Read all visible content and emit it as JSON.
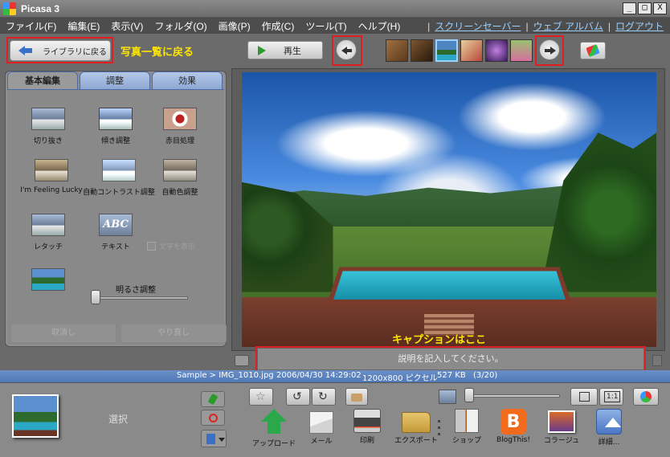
{
  "window": {
    "title": "Picasa 3",
    "buttons": [
      "_",
      "□",
      "X"
    ]
  },
  "menu": {
    "items": [
      "ファイル(F)",
      "編集(E)",
      "表示(V)",
      "フォルダ(O)",
      "画像(P)",
      "作成(C)",
      "ツール(T)",
      "ヘルプ(H)"
    ],
    "separator": "|",
    "links": [
      "スクリーンセーバー",
      "ウェブ アルバム",
      "ログアウト"
    ]
  },
  "toolbar": {
    "back_to_library": "ライブラリに戻る",
    "play": "再生"
  },
  "annotations": {
    "back_to_list": "写真一覧に戻る",
    "prev": "戻る",
    "next": "進む",
    "caption_here": "キャプションはここ"
  },
  "filmstrip_colors": [
    "#7a5530",
    "#5a3a1e",
    "#4e86c4",
    "#b8473a",
    "#6b3a8a",
    "#d76f9e"
  ],
  "panel": {
    "tabs": [
      "基本編集",
      "調整",
      "効果"
    ],
    "tools": [
      "切り抜き",
      "傾き調整",
      "赤目処理",
      "I'm Feeling Lucky",
      "自動コントラスト調整",
      "自動色調整",
      "レタッチ",
      "テキスト"
    ],
    "text_icon_glyph": "ABC",
    "checkbox_label": "文字を表示",
    "brightness_label": "明るさ調整",
    "undo": "取消し",
    "redo": "やり直し"
  },
  "caption": {
    "placeholder": "説明を記入してください。"
  },
  "status": {
    "path": "Sample > IMG_1010.jpg",
    "datetime": "2006/04/30 14:29:02",
    "dimensions": "1200x800 ピクセル",
    "size": "527 KB",
    "position": "(3/20)"
  },
  "tray": {
    "label": "選択",
    "one_to_one": "1:1",
    "actions": [
      "アップロード",
      "メール",
      "印刷",
      "エクスポート",
      "ショップ",
      "BlogThis!",
      "コラージュ",
      "詳細..."
    ],
    "blog_glyph": "B",
    "rotate_left_glyph": "↺",
    "rotate_right_glyph": "↻",
    "star_glyph": "☆"
  },
  "colors": {
    "accent_red": "#e02020",
    "annotation_yellow": "#ffe600",
    "link_blue": "#9cd0ff",
    "status_blue": "#5a82be"
  }
}
